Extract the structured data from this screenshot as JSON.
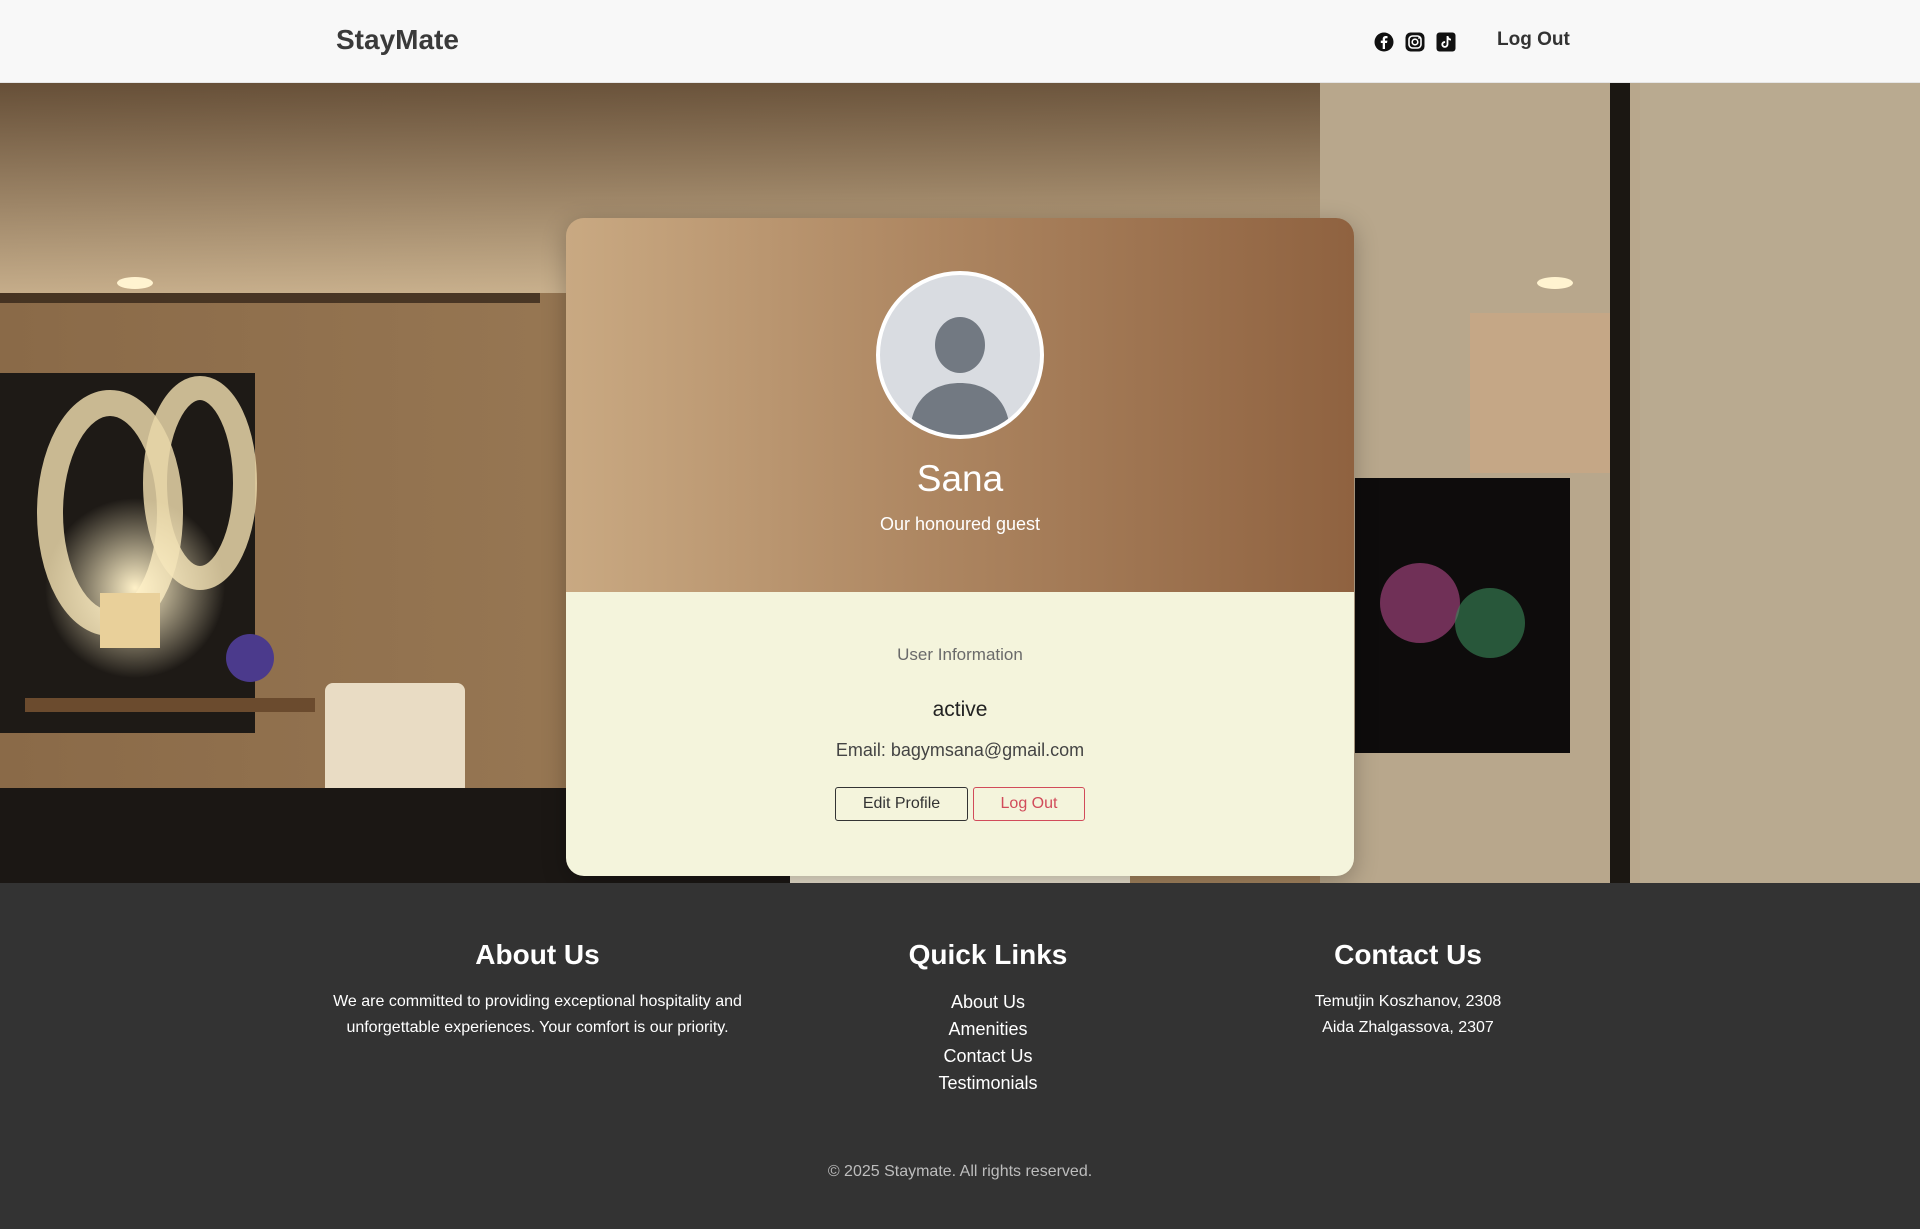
{
  "header": {
    "brand": "StayMate",
    "social_icons": [
      "facebook-icon",
      "instagram-icon",
      "tiktok-icon"
    ],
    "logout_label": "Log Out"
  },
  "profile": {
    "name": "Sana",
    "subtitle": "Our honoured guest",
    "info_heading": "User Information",
    "status": "active",
    "email": "Email: bagymsana@gmail.com",
    "edit_label": "Edit Profile",
    "logout_label": "Log Out"
  },
  "footer": {
    "about": {
      "title": "About Us",
      "line1": "We are committed to providing exceptional hospitality and",
      "line2": "unforgettable experiences. Your comfort is our priority."
    },
    "links": {
      "title": "Quick Links",
      "items": [
        "About Us",
        "Amenities",
        "Contact Us",
        "Testimonials"
      ]
    },
    "contact": {
      "title": "Contact Us",
      "lines": [
        "Temutjin Koszhanov, 2308",
        "Aida Zhalgassova, 2307"
      ]
    },
    "copyright": "© 2025 Staymate. All rights reserved."
  },
  "colors": {
    "card_gradient_start": "#c9a982",
    "card_gradient_end": "#8f6240",
    "card_bottom": "#f4f4dc",
    "logout_accent": "#d14b5a",
    "footer_bg": "#333333"
  }
}
